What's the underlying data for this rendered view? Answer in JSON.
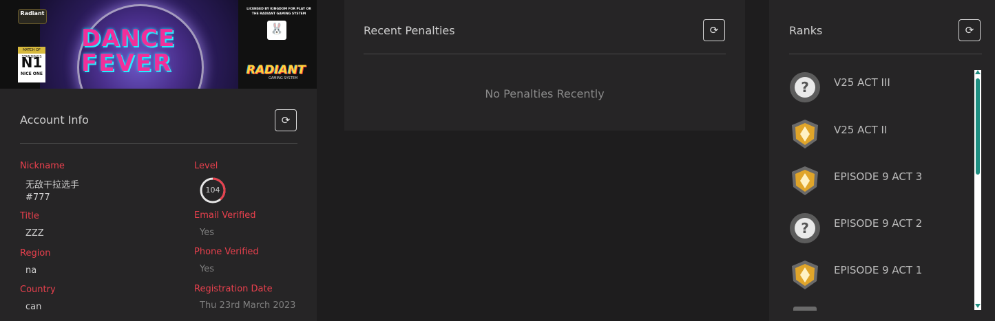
{
  "account_card": {
    "banner": {
      "title_line1": "DANCE",
      "title_line2": "FEVER",
      "badge_text": "N1",
      "badge_top": "MATCH OF STANDINGS",
      "badge_sub": "NICE ONE",
      "corner_logo": "Radiant",
      "license_text": "LICENSED BY KINGDOM FOR PLAY OR THE RADIANT GAMING SYSTEM",
      "usagi_label": "USAGI",
      "radiant_logo": "RADIANT",
      "radiant_sub": "GAMING SYSTEM"
    },
    "title": "Account Info",
    "refresh_icon": "refresh-icon",
    "fields": {
      "nickname_label": "Nickname",
      "nickname_value": "无敌干拉选手",
      "nickname_tag": "#777",
      "title_label": "Title",
      "title_value": "ZZZ",
      "region_label": "Region",
      "region_value": "na",
      "country_label": "Country",
      "country_value": "can",
      "level_label": "Level",
      "level_value": "104",
      "email_label": "Email Verified",
      "email_value": "Yes",
      "phone_label": "Phone Verified",
      "phone_value": "Yes",
      "registration_label": "Registration Date",
      "registration_value": "Thu 23rd March 2023"
    }
  },
  "penalties_card": {
    "title": "Recent Penalties",
    "refresh_icon": "refresh-icon",
    "empty_text": "No Penalties Recently"
  },
  "ranks_card": {
    "title": "Ranks",
    "refresh_icon": "refresh-icon",
    "items": [
      {
        "name": "V25 ACT III",
        "icon": "unranked-icon"
      },
      {
        "name": "V25 ACT II",
        "icon": "gold-rank-icon"
      },
      {
        "name": "EPISODE 9 ACT 3",
        "icon": "gold-rank-icon"
      },
      {
        "name": "EPISODE 9 ACT 2",
        "icon": "unranked-icon"
      },
      {
        "name": "EPISODE 9 ACT 1",
        "icon": "gold-rank-icon"
      }
    ]
  },
  "colors": {
    "background": "#1e1d1e",
    "card": "#262526",
    "label_red": "#e8404d",
    "scroll_accent": "#1f8f82",
    "gold": "#e0a52a"
  }
}
